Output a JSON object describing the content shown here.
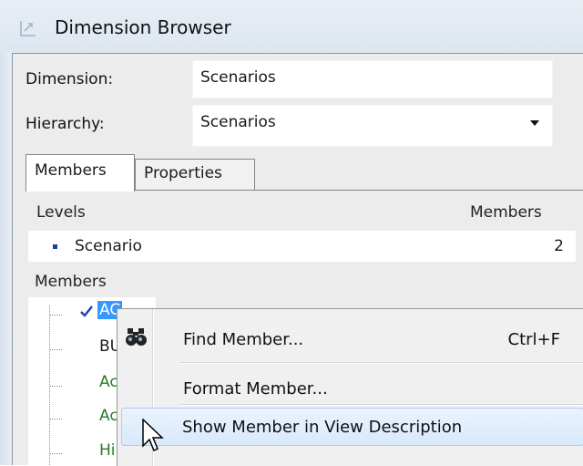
{
  "window": {
    "title": "Dimension Browser"
  },
  "form": {
    "dimension_label": "Dimension:",
    "dimension_value": "Scenarios",
    "hierarchy_label": "Hierarchy:",
    "hierarchy_value": "Scenarios"
  },
  "tabs": [
    {
      "label": "Members",
      "active": true
    },
    {
      "label": "Properties",
      "active": false
    }
  ],
  "levels": {
    "header": "Levels",
    "count_header": "Members",
    "rows": [
      {
        "name": "Scenario",
        "count": "2"
      }
    ]
  },
  "members": {
    "header": "Members",
    "items": [
      {
        "text": "AC",
        "color": "#ffffff",
        "selected": true,
        "checked": true
      },
      {
        "text": "BU",
        "color": "#111111"
      },
      {
        "text": "Ac",
        "color": "#2a7a2a"
      },
      {
        "text": "Ac",
        "color": "#2a7a2a"
      },
      {
        "text": "Hi",
        "color": "#2a7a2a"
      }
    ]
  },
  "context_menu": {
    "items": [
      {
        "label": "Find Member...",
        "shortcut": "Ctrl+F",
        "icon": "binoculars-icon"
      },
      {
        "label": "Format Member..."
      },
      {
        "label": "Show Member in View Description",
        "highlighted": true
      }
    ]
  },
  "colors": {
    "selection": "#3399ff",
    "menu_highlight": "#d8e9fb",
    "green_member": "#2a7a2a"
  }
}
